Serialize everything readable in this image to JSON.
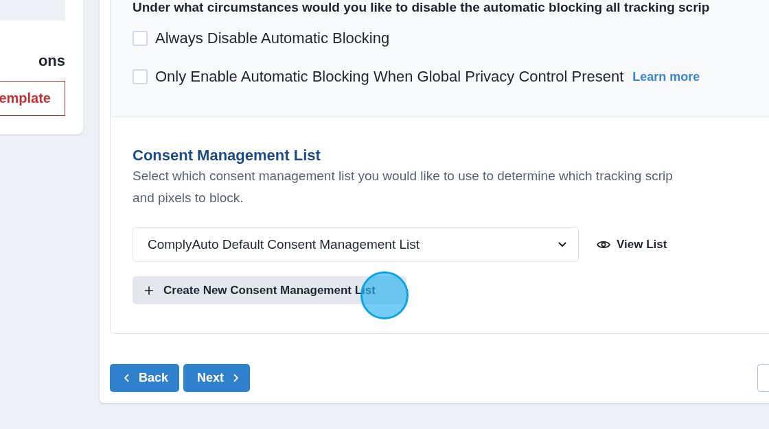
{
  "sidebar_card": {
    "heading": "ons",
    "template_button": "emplate"
  },
  "blocking_section": {
    "question": "Under what circumstances would you like to disable the automatic blocking all tracking scrip",
    "options": [
      {
        "label": "Always Disable Automatic Blocking",
        "checked": false
      },
      {
        "label": "Only Enable Automatic Blocking When Global Privacy Control Present",
        "checked": false,
        "link": "Learn more"
      }
    ]
  },
  "consent_section": {
    "title": "Consent Management List",
    "description_lines": [
      "Select which consent management list you would like to use to determine which tracking scrip",
      "and pixels to block."
    ],
    "select_value": "ComplyAuto Default Consent Management List",
    "view_link": "View List",
    "create_button": "Create New Consent Management List"
  },
  "footer": {
    "back_button": "Back",
    "next_button": "Next"
  }
}
